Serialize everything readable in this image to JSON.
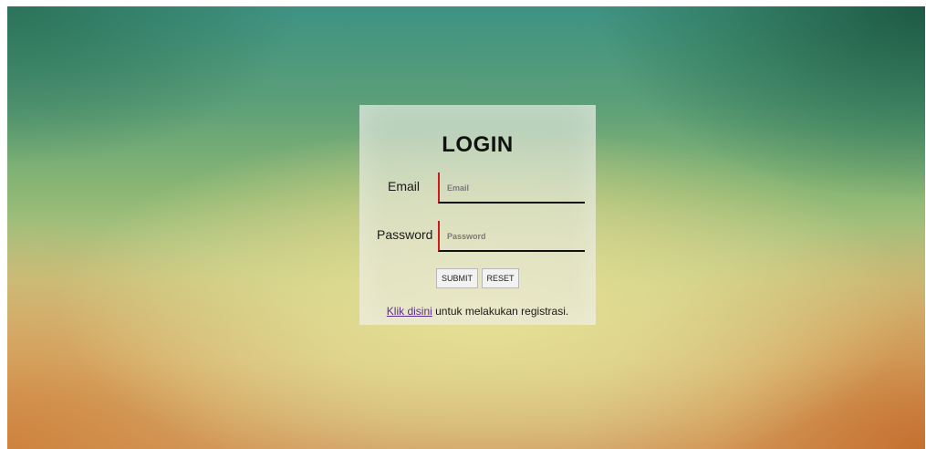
{
  "login": {
    "title": "LOGIN",
    "email": {
      "label": "Email",
      "placeholder": "Email",
      "value": ""
    },
    "password": {
      "label": "Password",
      "placeholder": "Password",
      "value": ""
    },
    "buttons": {
      "submit": "SUBMIT",
      "reset": "RESET"
    },
    "register": {
      "link_text": "Klik disini",
      "text": " untuk melakukan registrasi."
    }
  },
  "colors": {
    "input_left_border": "#cc1a1a",
    "input_bottom_border": "#111111",
    "link": "#5b2d8e"
  }
}
